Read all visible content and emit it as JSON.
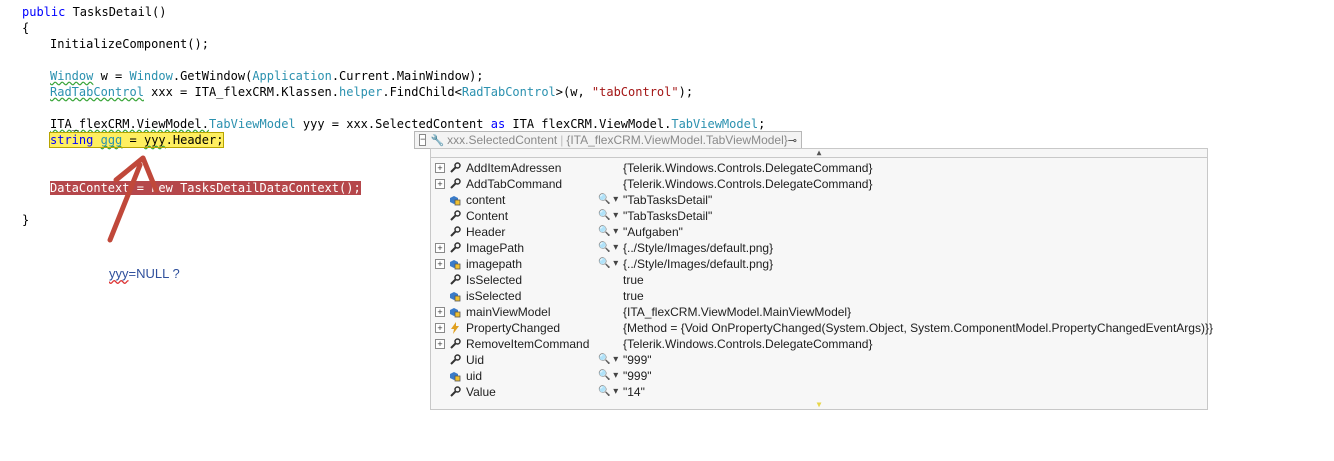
{
  "code": {
    "l1_kw": "public",
    "l1_rest": " TasksDetail()",
    "l2": "{",
    "l3": "InitializeComponent();",
    "l5_t1": "Window",
    "l5_a": " w = ",
    "l5_t2": "Window",
    "l5_b": ".GetWindow(",
    "l5_t3": "Application",
    "l5_c": ".Current.MainWindow);",
    "l6_t1": "RadTabControl",
    "l6_a": " xxx = ITA_flexCRM.Klassen.",
    "l6_t2": "helper",
    "l6_b": ".FindChild<",
    "l6_t3": "RadTabControl",
    "l6_c": ">(w, ",
    "l6_str": "\"tabControl\"",
    "l6_d": ");",
    "l8_a": "ITA_flexCRM.ViewModel.",
    "l8_t1": "TabViewModel",
    "l8_b": " yyy = xxx.SelectedContent ",
    "l8_kw": "as",
    "l8_c": " ITA flexCRM.ViewModel.",
    "l8_t2": "TabViewModel",
    "l8_d": ";",
    "l9_kw": "string",
    "l9_rest_a": " ",
    "l9_var": "ggg",
    "l9_rest_b": " = ",
    "l9_yyy": "yyy",
    "l9_rest_c": ".Header;",
    "l12_a": "DataContext = ",
    "l12_kw": "new",
    "l12_b": " TasksDetailDataContext();",
    "l14": "}"
  },
  "annotation": {
    "word": "yyy",
    "rest": "=NULL ?"
  },
  "datatip": {
    "expression": "xxx.SelectedContent",
    "type": "{ITA_flexCRM.ViewModel.TabViewModel}",
    "rows": [
      {
        "expand": true,
        "icon": "wrench-icon",
        "name": "AddItemAdressen",
        "viewer": false,
        "value": "{Telerik.Windows.Controls.DelegateCommand}"
      },
      {
        "expand": true,
        "icon": "wrench-icon",
        "name": "AddTabCommand",
        "viewer": false,
        "value": "{Telerik.Windows.Controls.DelegateCommand}"
      },
      {
        "expand": false,
        "icon": "private-field-icon",
        "name": "content",
        "viewer": true,
        "value": "\"TabTasksDetail\""
      },
      {
        "expand": false,
        "icon": "wrench-icon",
        "name": "Content",
        "viewer": true,
        "value": "\"TabTasksDetail\""
      },
      {
        "expand": false,
        "icon": "wrench-icon",
        "name": "Header",
        "viewer": true,
        "value": "\"Aufgaben\""
      },
      {
        "expand": true,
        "icon": "wrench-icon",
        "name": "ImagePath",
        "viewer": true,
        "value": "{../Style/Images/default.png}"
      },
      {
        "expand": true,
        "icon": "private-field-icon",
        "name": "imagepath",
        "viewer": true,
        "value": "{../Style/Images/default.png}"
      },
      {
        "expand": false,
        "icon": "wrench-icon",
        "name": "IsSelected",
        "viewer": false,
        "value": "true"
      },
      {
        "expand": false,
        "icon": "private-field-icon",
        "name": "isSelected",
        "viewer": false,
        "value": "true"
      },
      {
        "expand": true,
        "icon": "private-field-icon",
        "name": "mainViewModel",
        "viewer": false,
        "value": "{ITA_flexCRM.ViewModel.MainViewModel}"
      },
      {
        "expand": true,
        "icon": "lightning-icon",
        "name": "PropertyChanged",
        "viewer": false,
        "value": "{Method = {Void OnPropertyChanged(System.Object, System.ComponentModel.PropertyChangedEventArgs)}}"
      },
      {
        "expand": true,
        "icon": "wrench-icon",
        "name": "RemoveItemCommand",
        "viewer": false,
        "value": "{Telerik.Windows.Controls.DelegateCommand}"
      },
      {
        "expand": false,
        "icon": "wrench-icon",
        "name": "Uid",
        "viewer": true,
        "value": "\"999\""
      },
      {
        "expand": false,
        "icon": "private-field-icon",
        "name": "uid",
        "viewer": true,
        "value": "\"999\""
      },
      {
        "expand": false,
        "icon": "wrench-icon",
        "name": "Value",
        "viewer": true,
        "value": "\"14\""
      }
    ]
  },
  "colors": {
    "keyword": "#0000ff",
    "type": "#2b91af",
    "string": "#a31515",
    "current_statement": "#ffef60",
    "breakpoint": "#b5474b",
    "annotation_arrow": "#c0483a"
  }
}
